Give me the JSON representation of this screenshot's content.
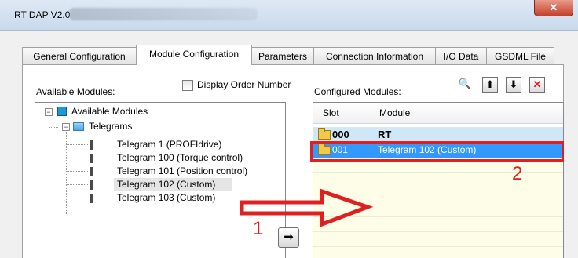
{
  "window": {
    "title": "RT DAP V2.0",
    "close_glyph": "✕"
  },
  "tabs": [
    {
      "label": "General Configuration"
    },
    {
      "label": "Module Configuration"
    },
    {
      "label": "Parameters"
    },
    {
      "label": "Connection Information"
    },
    {
      "label": "I/O Data"
    },
    {
      "label": "GSDML File"
    }
  ],
  "active_tab": "Module Configuration",
  "left": {
    "header_label": "Available Modules:",
    "display_order_label": "Display Order Number",
    "display_order_checked": false,
    "tree": {
      "root_label": "Available Modules",
      "root_expander": "−",
      "group_label": "Telegrams",
      "group_expander": "−",
      "items": [
        {
          "label": "Telegram 1 (PROFIdrive)"
        },
        {
          "label": "Telegram 100 (Torque control)"
        },
        {
          "label": "Telegram 101 (Position control)"
        },
        {
          "label": "Telegram 102 (Custom)",
          "selected": true
        },
        {
          "label": "Telegram 103 (Custom)"
        }
      ]
    },
    "move_button_icon": "arrow-right-icon",
    "move_button_glyph": "➡"
  },
  "right": {
    "header_label": "Configured Modules:",
    "toolbar": [
      {
        "icon": "magnifier-icon",
        "glyph": "🔍"
      },
      {
        "icon": "arrow-up-icon",
        "glyph": "⬆"
      },
      {
        "icon": "arrow-down-icon",
        "glyph": "⬇"
      },
      {
        "icon": "delete-icon",
        "glyph": "✕"
      }
    ],
    "columns": [
      "Slot",
      "Module"
    ],
    "rows": [
      {
        "slot": "000",
        "module": "RT",
        "bold": true
      },
      {
        "slot": "001",
        "module": "Telegram 102 (Custom)",
        "selected": true
      }
    ]
  },
  "annotations": {
    "step1": "1",
    "step2": "2"
  },
  "colors": {
    "annotation": "#e02020",
    "selection": "#3399ff",
    "highlight_row": "#cfe7f7",
    "empty_grid": "#fdfde8"
  }
}
